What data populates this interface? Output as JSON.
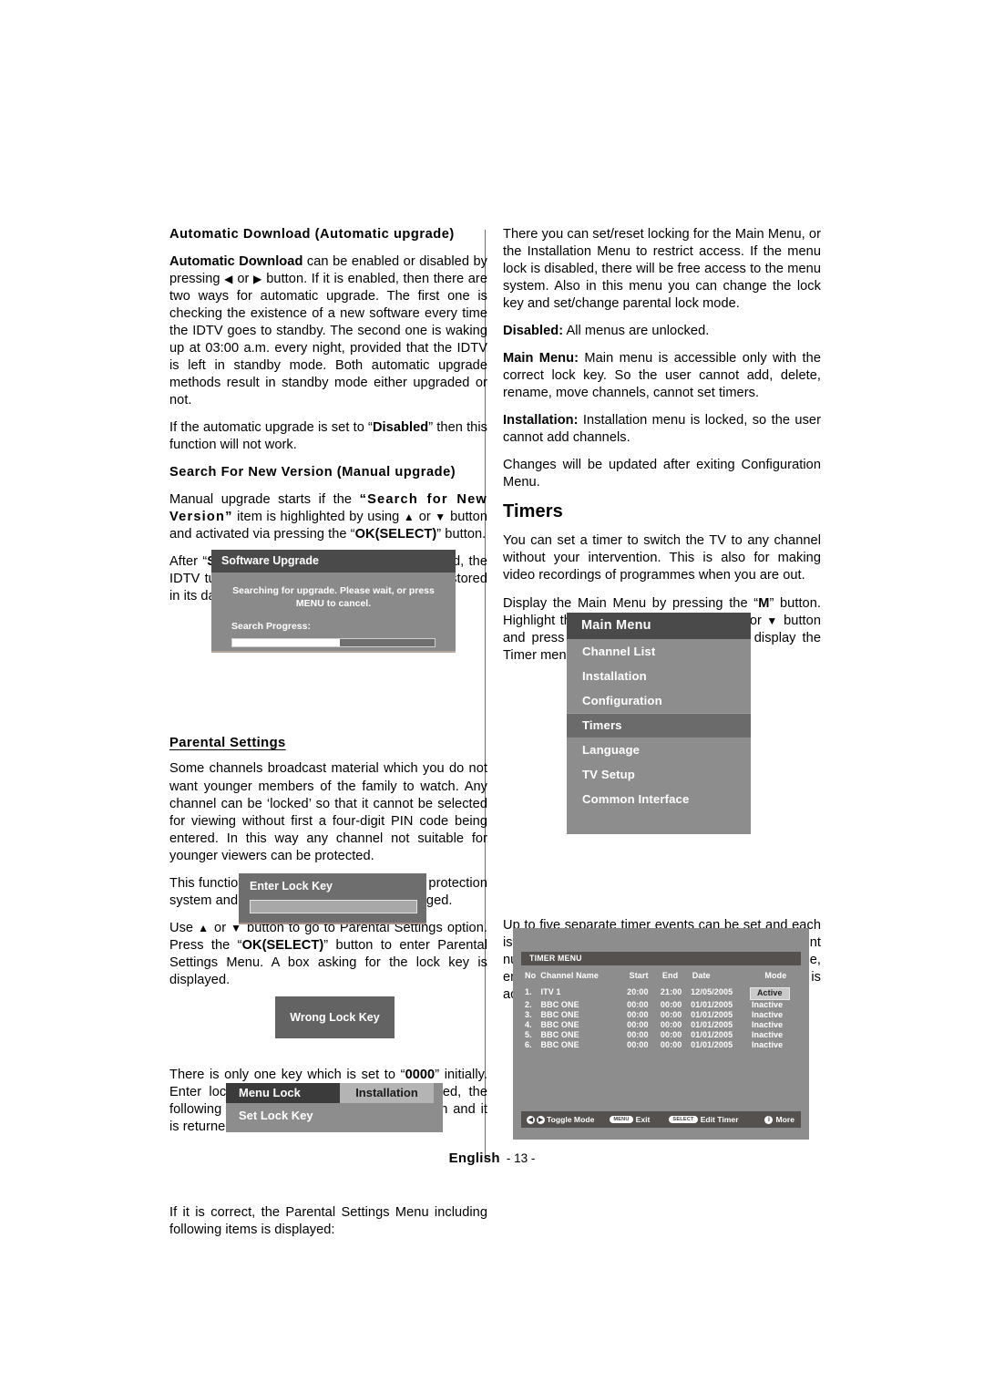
{
  "left_column": {
    "heading_automatic_download": "Automatic Download (Automatic upgrade)",
    "para_auto_1_a": "Automatic Download",
    "para_auto_1_b": " can be enabled or disabled by pressing ",
    "para_auto_1_c": " or ",
    "para_auto_1_d": " button. If it is enabled, then there are two ways for automatic upgrade. The first one is checking the existence of a new software every time the IDTV goes to standby. The second one is waking up at 03:00 a.m. every night, provided that the IDTV is left in standby mode. Both automatic upgrade methods result in standby mode either upgraded or not.",
    "para_auto_2_a": "If the automatic upgrade is set to “",
    "para_auto_2_b": "Disabled",
    "para_auto_2_c": "” then this function will not work.",
    "heading_search_version": "Search For New Version (Manual upgrade)",
    "para_manual_a": "Manual upgrade starts if the ",
    "para_manual_b": "“Search for New Version”",
    "para_manual_c": " item is highlighted by using ",
    "para_manual_d": " or ",
    "para_manual_e": " button and activated via pressing the “",
    "para_manual_f": "OK(SELECT)",
    "para_manual_g": "” button.",
    "para_after_a": "After “",
    "para_after_b": "Search for New Version",
    "para_after_c": "” is activated, the IDTV tunes to each frequency that have been stored in its database and looks for the new software.",
    "heading_parental": "Parental Settings",
    "para_parental_1": "Some channels broadcast material which you do not want younger members of the family to watch. Any channel can be ‘locked’ so that it cannot be selected for viewing without first a four-digit PIN code being entered. In this way any channel not suitable for younger viewers can be protected.",
    "para_parental_2": "This function enables or disables the menu protection system and allows the PIN code to be changed.",
    "para_use_a": "Use ",
    "para_use_b": " or ",
    "para_use_c": " button  to go to Parental Settings option. Press the “",
    "para_use_d": "OK(SELECT)",
    "para_use_e": "” button to enter Parental Settings Menu.  A box asking for the lock key is displayed.",
    "para_key_a": "There is only one key which is set to “",
    "para_key_b": "0000",
    "para_key_c": "” initially. Enter lock key. If wrong Lock key is entered, the following message is displayed on the screen and it is returned back.",
    "para_correct": "If it is correct, the Parental Settings Menu including following items is displayed:"
  },
  "right_column": {
    "para_lock_1": "There you can set/reset locking for the Main Menu, or the Installation Menu to restrict access. If the menu lock is disabled, there will be free access to the menu system. Also in this menu you can change the lock key and set/change parental lock mode.",
    "para_disabled_label": "Disabled:",
    "para_disabled_text": " All menus are unlocked.",
    "para_mainmenu_label": "Main Menu:",
    "para_mainmenu_text": " Main menu is accessible only with the correct lock key. So the user cannot add, delete, rename, move channels, cannot set timers.",
    "para_installation_label": "Installation:",
    "para_installation_text": " Installation menu is locked, so the user cannot add channels.",
    "para_changes": "Changes will be updated after exiting Configuration Menu.",
    "heading_timers": "Timers",
    "para_timers_1": "You can set a timer to switch the TV to any channel without your intervention. This is also for making video recordings of programmes when you are out.",
    "para_timers_2_a": "Display the Main Menu by pressing the “",
    "para_timers_2_b": "M",
    "para_timers_2_c": "” button. Highlight the ",
    "para_timers_2_d": "Timers",
    "para_timers_2_e": " line by pressing ",
    "para_timers_2_f": " or ",
    "para_timers_2_g": " button and press the “",
    "para_timers_2_h": "OK(SELECT)",
    "para_timers_2_i": "” button to display the Timer menu.",
    "para_five_timers": "Up to five separate timer events can be set and each is displayed in the Timer screen, showing the event number, the channel to be selected, the start time, end time, date and the mode - whether that event is active (and will be acted on) or not."
  },
  "software_upgrade_dialog": {
    "title": "Software Upgrade",
    "message": "Searching for upgrade. Please wait, or press MENU to cancel.",
    "progress_label": "Search Progress:",
    "progress_percent": 53
  },
  "enter_lock_key_dialog": {
    "title": "Enter Lock Key",
    "field_value": ""
  },
  "wrong_lock_key_dialog": {
    "message": "Wrong Lock Key"
  },
  "menu_lock_dialog": {
    "row1_label": "Menu Lock",
    "row1_value": "Installation",
    "row2_label": "Set Lock Key"
  },
  "main_menu": {
    "title": "Main Menu",
    "items": [
      {
        "label": "Channel List",
        "selected": false
      },
      {
        "label": "Installation",
        "selected": false
      },
      {
        "label": "Configuration",
        "selected": false
      },
      {
        "label": "Timers",
        "selected": true
      },
      {
        "label": "Language",
        "selected": false
      },
      {
        "label": "TV Setup",
        "selected": false
      },
      {
        "label": "Common Interface",
        "selected": false
      }
    ]
  },
  "timer_menu": {
    "title": "TIMER MENU",
    "columns": [
      "No",
      "Channel Name",
      "Start",
      "End",
      "Date",
      "Mode"
    ],
    "rows": [
      {
        "no": "1.",
        "channel": "ITV 1",
        "start": "20:00",
        "end": "21:00",
        "date": "12/05/2005",
        "mode": "Active",
        "active": true
      },
      {
        "no": "2.",
        "channel": "BBC ONE",
        "start": "00:00",
        "end": "00:00",
        "date": "01/01/2005",
        "mode": "Inactive",
        "active": false
      },
      {
        "no": "3.",
        "channel": "BBC ONE",
        "start": "00:00",
        "end": "00:00",
        "date": "01/01/2005",
        "mode": "Inactive",
        "active": false
      },
      {
        "no": "4.",
        "channel": "BBC ONE",
        "start": "00:00",
        "end": "00:00",
        "date": "01/01/2005",
        "mode": "Inactive",
        "active": false
      },
      {
        "no": "5.",
        "channel": "BBC ONE",
        "start": "00:00",
        "end": "00:00",
        "date": "01/01/2005",
        "mode": "Inactive",
        "active": false
      },
      {
        "no": "6.",
        "channel": "BBC ONE",
        "start": "00:00",
        "end": "00:00",
        "date": "01/01/2005",
        "mode": "Inactive",
        "active": false
      }
    ],
    "footer": {
      "toggle_label": "Toggle Mode",
      "exit_badge": "MENU",
      "exit_label": "Exit",
      "edit_badge": "SELECT",
      "edit_label": "Edit Timer",
      "more_label": "More"
    }
  },
  "footer": {
    "language": "English",
    "page": "- 13 -"
  },
  "glyphs": {
    "left": "◀",
    "right": "▶",
    "up": "▲",
    "down": "▼",
    "info": "i"
  }
}
